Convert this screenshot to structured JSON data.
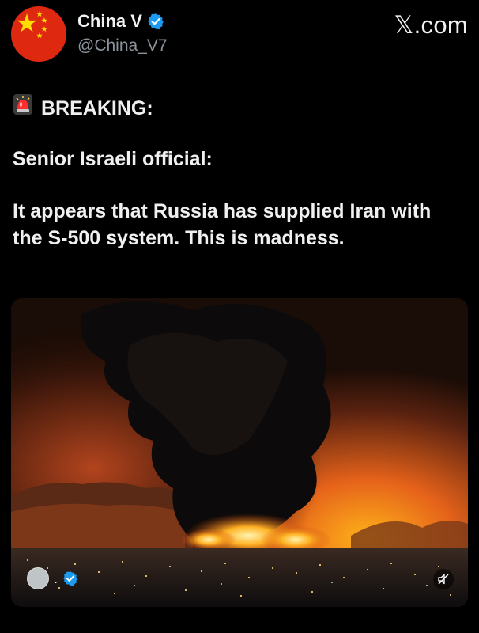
{
  "account": {
    "display_name": "China V",
    "handle": "@China_V7",
    "avatar_icon": "china-flag-icon"
  },
  "site": {
    "label": ".com",
    "logo_glyph": "𝕏"
  },
  "post": {
    "breaking_label": "BREAKING:",
    "breaking_icon": "siren-icon",
    "line1": "Senior Israeli official:",
    "line2": "It appears that Russia has supplied Iran with the S-500 system. This is madness."
  },
  "media": {
    "chip_suffix": ".",
    "mute_icon": "mute-icon"
  },
  "colors": {
    "background": "#000000",
    "verified": "#1d9bf0",
    "handle_gray": "#8b939b"
  }
}
